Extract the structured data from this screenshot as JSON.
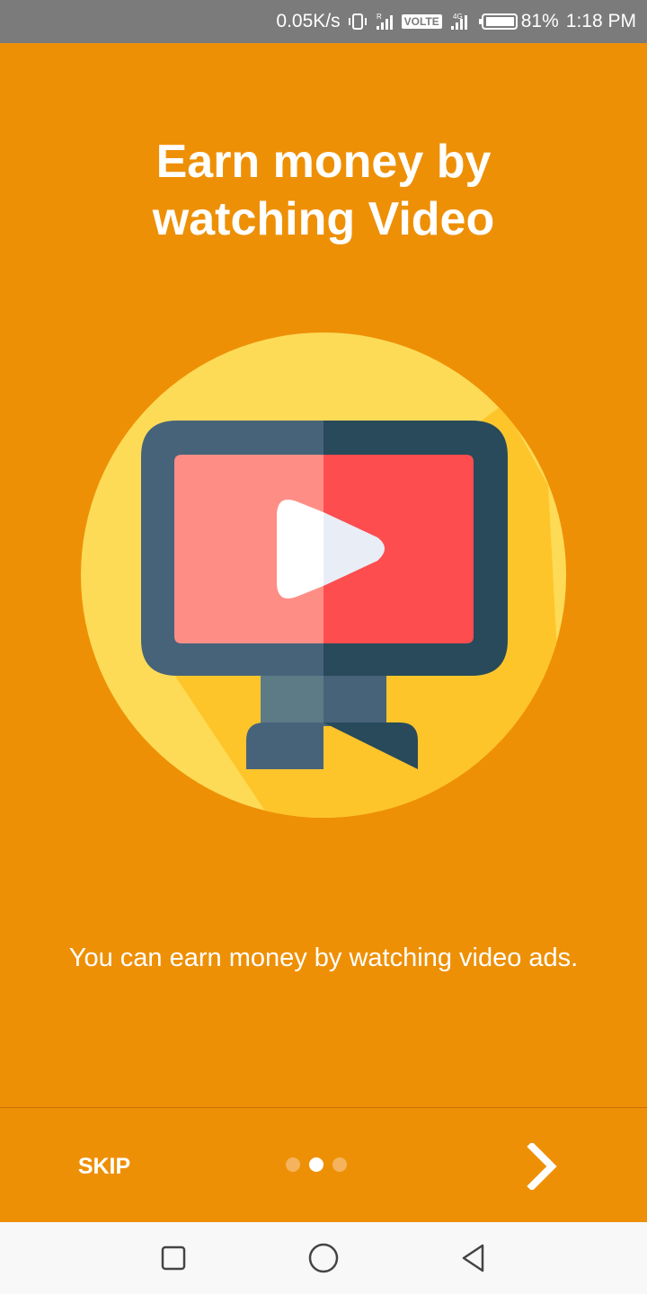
{
  "status_bar": {
    "network_speed": "0.05K/s",
    "sim1_indicator": "R",
    "volte": "VOLTE",
    "sim2_indicator": "4G",
    "battery": "81%",
    "time": "1:18 PM"
  },
  "onboarding": {
    "title_line1": "Earn money by",
    "title_line2": "watching Video",
    "description": "You can earn money by watching video ads.",
    "skip_label": "SKIP",
    "total_pages": 3,
    "current_page": 2,
    "illustration": "tv-play-icon"
  },
  "colors": {
    "background": "#EE9006",
    "circle": "#FDDB57",
    "circle_shadow": "#FEC52B",
    "monitor_light": "#46637A",
    "monitor_dark": "#284A5A",
    "screen_light": "#FE8E85",
    "screen_dark": "#FD4D4F"
  },
  "nav_bar": {
    "buttons": [
      "recents",
      "home",
      "back"
    ]
  }
}
